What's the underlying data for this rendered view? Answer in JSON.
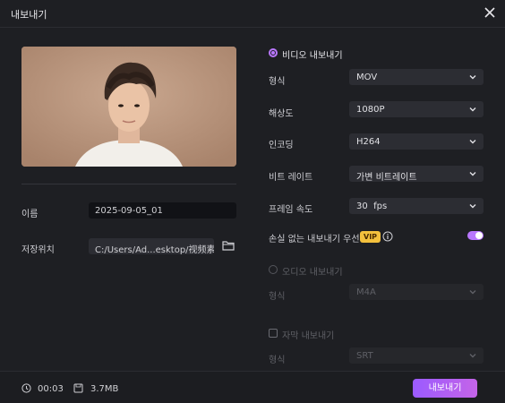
{
  "window": {
    "title": "내보내기"
  },
  "left": {
    "name_label": "이름",
    "name_value": "2025-09-05_01",
    "location_label": "저장위치",
    "location_value": "C:/Users/Ad...esktop/视频素材"
  },
  "video": {
    "section_label": "비디오 내보내기",
    "rows": [
      {
        "label": "형식",
        "value": "MOV"
      },
      {
        "label": "해상도",
        "value": "1080P"
      },
      {
        "label": "인코딩",
        "value": "H264"
      },
      {
        "label": "비트 레이트",
        "value": "가변 비트레이트"
      },
      {
        "label": "프레임 속도",
        "value": "30  fps"
      }
    ],
    "lossless_label": "손실 없는 내보내기 우선",
    "vip_badge": "VIP",
    "lossless_enabled": true
  },
  "audio": {
    "section_label": "오디오 내보내기",
    "format_label": "형식",
    "format_value": "M4A"
  },
  "subtitle": {
    "section_label": "자막 내보내기",
    "format_label": "형식",
    "format_value": "SRT"
  },
  "footer": {
    "duration": "00:03",
    "size": "3.7MB",
    "export_label": "내보내기"
  },
  "colors": {
    "accent": "#b977ff",
    "vip": "#f3c03d",
    "background": "#1e1f23"
  }
}
